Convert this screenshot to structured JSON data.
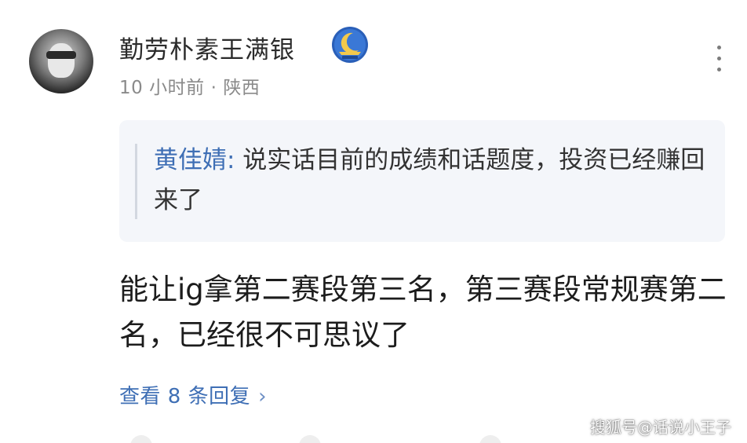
{
  "comment": {
    "username": "勤劳朴素王满银",
    "time": "10 小时前",
    "separator": "·",
    "location": "陕西",
    "quote": {
      "author": "黄佳婧:",
      "text": " 说实话目前的成绩和话题度，投资已经赚回来了"
    },
    "body": "能让ig拿第二赛段第三名，第三赛段常规赛第二名，已经很不可思议了",
    "replies_label": "查看 8 条回复",
    "replies_chevron": "›"
  },
  "icons": {
    "avatar": "avatar-image",
    "badge": "moon-badge-icon",
    "more": "more-vertical-icon"
  },
  "colors": {
    "link": "#3f6fb5",
    "quote_bg": "#f4f6fa",
    "meta": "#8a8a8a"
  },
  "watermark": "搜狐号@话说小王子"
}
